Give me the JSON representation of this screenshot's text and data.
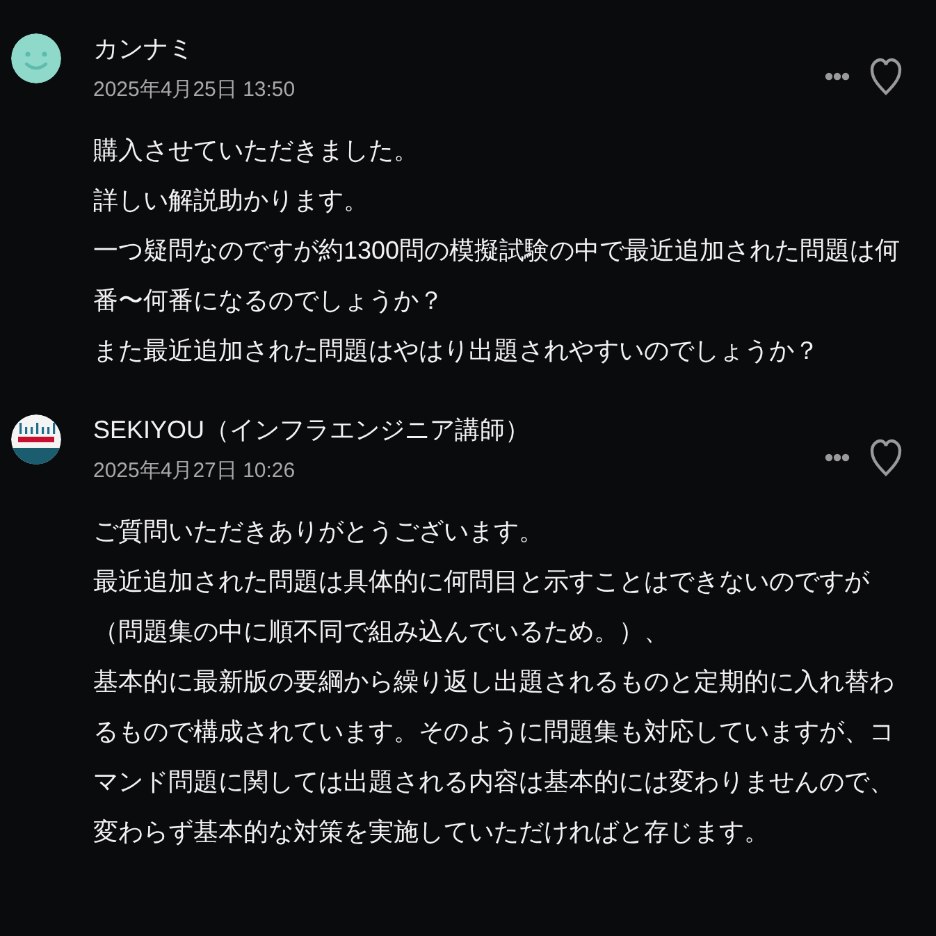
{
  "comments": [
    {
      "kind": "smiley",
      "author": "カンナミ",
      "date": "2025年4月25日 13:50",
      "liked": false,
      "paragraphs": [
        "購入させていただきました。",
        "詳しい解説助かります。",
        "一つ疑問なのですが約1300問の模擬試験の中で最近追加された問題は何番〜何番になるのでしょうか？",
        "また最近追加された問題はやはり出題されやすいのでしょうか？"
      ]
    },
    {
      "kind": "logo",
      "author": "SEKIYOU（インフラエンジニア講師）",
      "date": "2025年4月27日 10:26",
      "liked": false,
      "paragraphs": [
        "ご質問いただきありがとうございます。",
        "最近追加された問題は具体的に何問目と示すことはできないのですが（問題集の中に順不同で組み込んでいるため。）、",
        "基本的に最新版の要綱から繰り返し出題されるものと定期的に入れ替わるもので構成されています。そのように問題集も対応していますが、コマンド問題に関しては出題される内容は基本的には変わりませんので、変わらず基本的な対策を実施していただければと存じます。"
      ]
    }
  ]
}
